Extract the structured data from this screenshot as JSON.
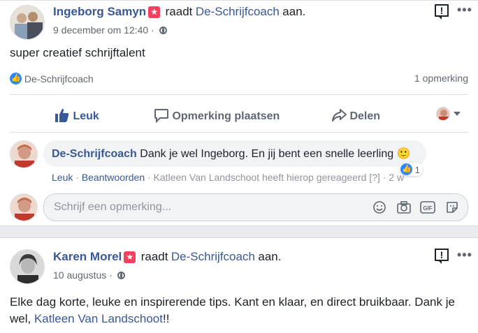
{
  "posts": [
    {
      "author": "Ingeborg Samyn",
      "verb": "raadt",
      "page": "De-Schrijfcoach",
      "suffix": "aan.",
      "date": "9 december om 12:40",
      "separator": "·",
      "text": "super creatief schrijftalent",
      "reactions_label": "De-Schrijfcoach",
      "comments_count": "1 opmerking",
      "actions": {
        "like": "Leuk",
        "comment": "Opmerking plaatsen",
        "share": "Delen"
      },
      "comment": {
        "author": "De-Schrijfcoach",
        "text": "Dank je wel Ingeborg. En jij bent een snelle leerling",
        "emoji": "🙂",
        "reaction_count": "1",
        "like": "Leuk",
        "reply": "Beantwoorden",
        "responded": "Katleen Van Landschoot heeft hierop gereageerd",
        "responded_mark": "[?]",
        "time": "2 w"
      },
      "input_placeholder": "Schrijf een opmerking..."
    },
    {
      "author": "Karen Morel",
      "verb": "raadt",
      "page": "De-Schrijfcoach",
      "suffix": "aan.",
      "date": "10 augustus",
      "separator": "·",
      "text_before": "Elke dag korte, leuke en inspirerende tips. Kant en klaar, en direct bruikbaar. Dank je wel,",
      "mention": "Katleen Van Landschoot",
      "text_after": "!!"
    }
  ],
  "icons": {
    "recommend": "star-badge-icon",
    "privacy": "globe-icon",
    "report": "report-icon",
    "more": "more-options-icon",
    "like": "thumbs-up-icon",
    "comment": "speech-bubble-icon",
    "share": "share-arrow-icon",
    "emoji": "emoji-icon",
    "camera": "camera-icon",
    "gif": "gif-icon",
    "sticker": "sticker-icon"
  },
  "colors": {
    "link": "#385898",
    "like_blue": "#2d88ff",
    "recommend_red": "#f3425f"
  }
}
